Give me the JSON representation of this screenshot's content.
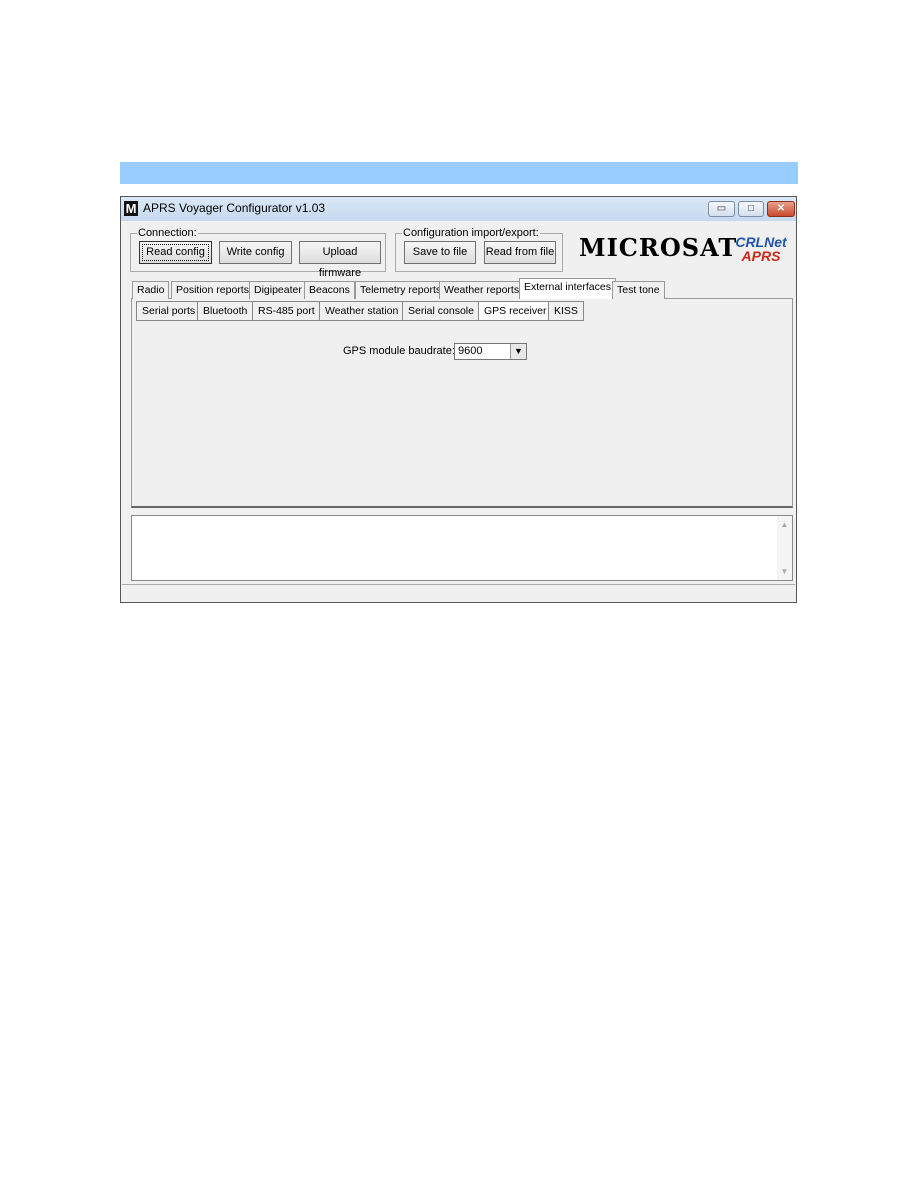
{
  "window": {
    "title": "APRS Voyager Configurator v1.03",
    "app_icon": "M",
    "controls": {
      "minimize": "▭",
      "maximize": "□",
      "close": "✕"
    }
  },
  "connection": {
    "label": "Connection:",
    "read": "Read config",
    "write": "Write config",
    "upload": "Upload firmware"
  },
  "config_io": {
    "label": "Configuration import/export:",
    "save": "Save to file",
    "read": "Read from file"
  },
  "logos": {
    "microsat": "MICROSAT",
    "crlnet": "CRLNet",
    "aprs": "APRS"
  },
  "tabs": [
    "Radio",
    "Position reports",
    "Digipeater",
    "Beacons",
    "Telemetry reports",
    "Weather reports",
    "External interfaces",
    "Test tone"
  ],
  "active_tab": "External interfaces",
  "subtabs": [
    "Serial ports",
    "Bluetooth",
    "RS-485 port",
    "Weather station",
    "Serial console",
    "GPS receiver",
    "KISS"
  ],
  "active_subtab": "GPS receiver",
  "gps": {
    "label": "GPS module baudrate:",
    "value": "9600"
  },
  "log": {
    "text": ""
  },
  "status": {
    "text": ""
  },
  "colors": {
    "banner": "#99ccff",
    "close": "#c74a2e"
  }
}
